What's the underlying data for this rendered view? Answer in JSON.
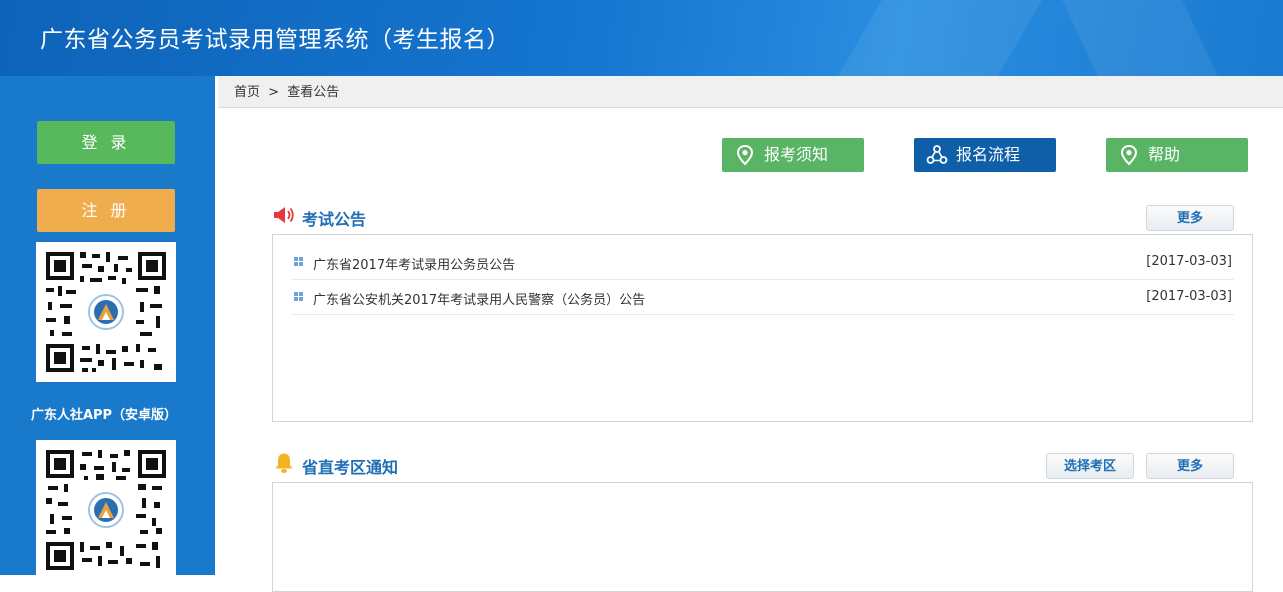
{
  "header": {
    "title": "广东省公务员考试录用管理系统（考生报名）"
  },
  "sidebar": {
    "login_label": "登 录",
    "register_label": "注 册",
    "app_label": "广东人社APP（安卓版）"
  },
  "breadcrumb": {
    "home": "首页",
    "separator": ">",
    "current": "查看公告"
  },
  "actions": {
    "notice_label": "报考须知",
    "process_label": "报名流程",
    "help_label": "帮助"
  },
  "exam_announcements": {
    "title": "考试公告",
    "more_label": "更多",
    "items": [
      {
        "title": "广东省2017年考试录用公务员公告",
        "date": "[2017-03-03]"
      },
      {
        "title": "广东省公安机关2017年考试录用人民警察（公务员）公告",
        "date": "[2017-03-03]"
      }
    ]
  },
  "district_notices": {
    "title": "省直考区通知",
    "select_label": "选择考区",
    "more_label": "更多"
  },
  "colors": {
    "header_blue": "#1575cf",
    "sidebar_blue": "#1979ca",
    "login_green": "#57b85c",
    "register_orange": "#f0ad4e",
    "process_navy": "#0f5ea8",
    "title_blue": "#1f6fb6"
  },
  "icons": {
    "notice": "map-pin-icon",
    "process": "flow-nodes-icon",
    "help": "map-pin-icon",
    "announcement": "megaphone-icon",
    "district": "bell-icon"
  }
}
